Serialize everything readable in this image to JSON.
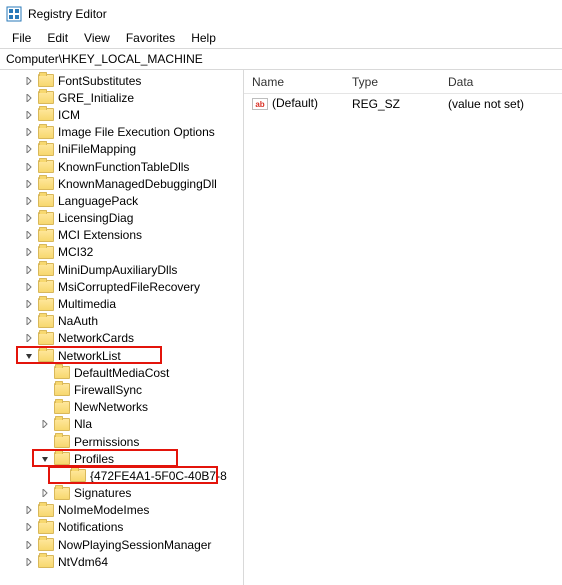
{
  "window": {
    "title": "Registry Editor"
  },
  "menu": {
    "file": "File",
    "edit": "Edit",
    "view": "View",
    "favorites": "Favorites",
    "help": "Help"
  },
  "address": "Computer\\HKEY_LOCAL_MACHINE",
  "columns": {
    "name": "Name",
    "type": "Type",
    "data": "Data"
  },
  "row": {
    "name": "(Default)",
    "type": "REG_SZ",
    "data": "(value not set)",
    "icon_label": "ab"
  },
  "tree": {
    "items": [
      {
        "label": "FontSubstitutes",
        "depth": 1,
        "expander": "right"
      },
      {
        "label": "GRE_Initialize",
        "depth": 1,
        "expander": "right"
      },
      {
        "label": "ICM",
        "depth": 1,
        "expander": "right"
      },
      {
        "label": "Image File Execution Options",
        "depth": 1,
        "expander": "right"
      },
      {
        "label": "IniFileMapping",
        "depth": 1,
        "expander": "right"
      },
      {
        "label": "KnownFunctionTableDlls",
        "depth": 1,
        "expander": "right"
      },
      {
        "label": "KnownManagedDebuggingDll",
        "depth": 1,
        "expander": "right"
      },
      {
        "label": "LanguagePack",
        "depth": 1,
        "expander": "right"
      },
      {
        "label": "LicensingDiag",
        "depth": 1,
        "expander": "right"
      },
      {
        "label": "MCI Extensions",
        "depth": 1,
        "expander": "right"
      },
      {
        "label": "MCI32",
        "depth": 1,
        "expander": "right"
      },
      {
        "label": "MiniDumpAuxiliaryDlls",
        "depth": 1,
        "expander": "right"
      },
      {
        "label": "MsiCorruptedFileRecovery",
        "depth": 1,
        "expander": "right"
      },
      {
        "label": "Multimedia",
        "depth": 1,
        "expander": "right"
      },
      {
        "label": "NaAuth",
        "depth": 1,
        "expander": "right"
      },
      {
        "label": "NetworkCards",
        "depth": 1,
        "expander": "right"
      },
      {
        "label": "NetworkList",
        "depth": 1,
        "expander": "down",
        "highlight": true
      },
      {
        "label": "DefaultMediaCost",
        "depth": 2,
        "expander": "none"
      },
      {
        "label": "FirewallSync",
        "depth": 2,
        "expander": "none"
      },
      {
        "label": "NewNetworks",
        "depth": 2,
        "expander": "none"
      },
      {
        "label": "Nla",
        "depth": 2,
        "expander": "right"
      },
      {
        "label": "Permissions",
        "depth": 2,
        "expander": "none"
      },
      {
        "label": "Profiles",
        "depth": 2,
        "expander": "down",
        "highlight": true
      },
      {
        "label": "{472FE4A1-5F0C-40B7-8",
        "depth": 3,
        "expander": "none",
        "highlight": true
      },
      {
        "label": "Signatures",
        "depth": 2,
        "expander": "right"
      },
      {
        "label": "NoImeModeImes",
        "depth": 1,
        "expander": "right"
      },
      {
        "label": "Notifications",
        "depth": 1,
        "expander": "right"
      },
      {
        "label": "NowPlayingSessionManager",
        "depth": 1,
        "expander": "right"
      },
      {
        "label": "NtVdm64",
        "depth": 1,
        "expander": "right"
      }
    ]
  }
}
